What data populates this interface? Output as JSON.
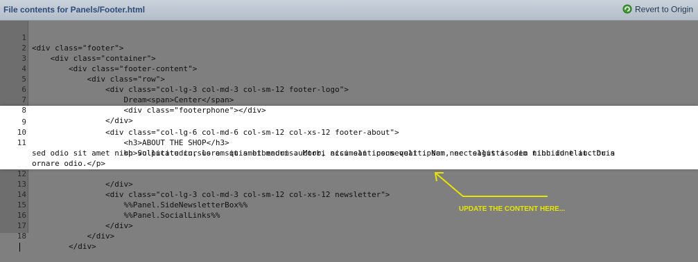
{
  "titlebar": {
    "title": "File contents for Panels/Footer.html",
    "revert_label": "Revert to Origin",
    "revert_icon": "revert-arrow-icon"
  },
  "editor": {
    "lines": [
      {
        "n": "1",
        "text": "<div class=\"footer\">"
      },
      {
        "n": "2",
        "text": "    <div class=\"container\">"
      },
      {
        "n": "3",
        "text": "        <div class=\"footer-content\">"
      },
      {
        "n": "4",
        "text": "            <div class=\"row\">"
      },
      {
        "n": "5",
        "text": "                <div class=\"col-lg-3 col-md-3 col-sm-12 footer-logo\">"
      },
      {
        "n": "6",
        "text": "                    Dream<span>Center</span>"
      },
      {
        "n": "7",
        "text": "                    <div class=\"footerphone\"></div>"
      },
      {
        "n": "8",
        "text": "                </div>"
      },
      {
        "n": "9",
        "text": "                <div class=\"col-lg-6 col-md-6 col-sm-12 col-xs-12 footer-about\">"
      },
      {
        "n": "10",
        "text": "                    <h3>ABOUT THE SHOP</h3>"
      },
      {
        "n": "11",
        "text": "                    <p>Sollicitudin, lorem quis bibendum auctor, nisi elit consequat ipsum, nec sagittis sem nibh id elit. Duis"
      },
      {
        "n": "",
        "text": "sed odio sit amet nibh vulputate cursus a sit amet mauris. Morbi accumsan ipsum velit. Nam nec tellus a odio tincidunt auctor a"
      },
      {
        "n": "",
        "text": "ornare odio.</p>"
      },
      {
        "n": "12",
        "text": "                </div>"
      },
      {
        "n": "13",
        "text": "                <div class=\"col-lg-3 col-md-3 col-sm-12 col-xs-12 newsletter\">"
      },
      {
        "n": "14",
        "text": "                    %%Panel.SideNewsletterBox%%"
      },
      {
        "n": "15",
        "text": "                    %%Panel.SocialLinks%%"
      },
      {
        "n": "16",
        "text": "                </div>"
      },
      {
        "n": "17",
        "text": "            </div>"
      },
      {
        "n": "18",
        "text": "        </div>"
      }
    ]
  },
  "annotation": {
    "text": "UPDATE THE CONTENT HERE...",
    "color": "#e6e600"
  },
  "colors": {
    "dim_overlay": "#7f7f7f",
    "highlight": "#ffffff",
    "title": "#2c4a78"
  }
}
